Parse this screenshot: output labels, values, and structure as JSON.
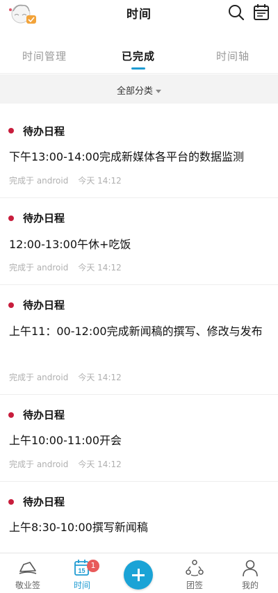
{
  "header": {
    "title": "时间"
  },
  "tabs": [
    {
      "label": "时间管理",
      "active": false
    },
    {
      "label": "已完成",
      "active": true
    },
    {
      "label": "时间轴",
      "active": false
    }
  ],
  "filter": {
    "label": "全部分类"
  },
  "items": [
    {
      "category": "待办日程",
      "content": "下午13:00-14:00完成新媒体各平台的数据监测",
      "source": "完成于 android",
      "time": "今天 14:12"
    },
    {
      "category": "待办日程",
      "content": "12:00-13:00午休+吃饭",
      "source": "完成于 android",
      "time": "今天 14:12"
    },
    {
      "category": "待办日程",
      "content": "上午11：00-12:00完成新闻稿的撰写、修改与发布",
      "source": "完成于 android",
      "time": "今天 14:12"
    },
    {
      "category": "待办日程",
      "content": "上午10:00-11:00开会",
      "source": "完成于 android",
      "time": "今天 14:12"
    },
    {
      "category": "待办日程",
      "content": "上午8:30-10:00撰写新闻稿",
      "source": "",
      "time": ""
    }
  ],
  "bottom_nav": [
    {
      "label": "敬业签",
      "icon": "ship-icon"
    },
    {
      "label": "时间",
      "icon": "calendar-15-icon",
      "badge": "1",
      "calendar_day": "15",
      "active": true
    },
    {
      "label": "",
      "icon": "plus-icon"
    },
    {
      "label": "团签",
      "icon": "team-icon"
    },
    {
      "label": "我的",
      "icon": "person-icon"
    }
  ],
  "colors": {
    "accent": "#1e9bd2",
    "dot": "#c81d3c",
    "badge": "#e85a5a"
  }
}
